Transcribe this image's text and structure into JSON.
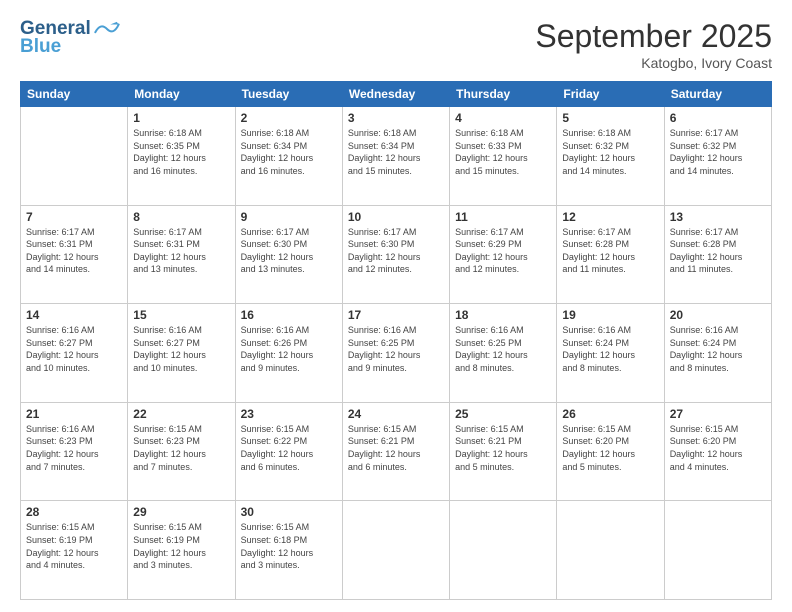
{
  "header": {
    "logo_line1": "General",
    "logo_line2": "Blue",
    "month_title": "September 2025",
    "location": "Katogbo, Ivory Coast"
  },
  "weekdays": [
    "Sunday",
    "Monday",
    "Tuesday",
    "Wednesday",
    "Thursday",
    "Friday",
    "Saturday"
  ],
  "weeks": [
    [
      {
        "day": "",
        "info": ""
      },
      {
        "day": "1",
        "info": "Sunrise: 6:18 AM\nSunset: 6:35 PM\nDaylight: 12 hours\nand 16 minutes."
      },
      {
        "day": "2",
        "info": "Sunrise: 6:18 AM\nSunset: 6:34 PM\nDaylight: 12 hours\nand 16 minutes."
      },
      {
        "day": "3",
        "info": "Sunrise: 6:18 AM\nSunset: 6:34 PM\nDaylight: 12 hours\nand 15 minutes."
      },
      {
        "day": "4",
        "info": "Sunrise: 6:18 AM\nSunset: 6:33 PM\nDaylight: 12 hours\nand 15 minutes."
      },
      {
        "day": "5",
        "info": "Sunrise: 6:18 AM\nSunset: 6:32 PM\nDaylight: 12 hours\nand 14 minutes."
      },
      {
        "day": "6",
        "info": "Sunrise: 6:17 AM\nSunset: 6:32 PM\nDaylight: 12 hours\nand 14 minutes."
      }
    ],
    [
      {
        "day": "7",
        "info": "Sunrise: 6:17 AM\nSunset: 6:31 PM\nDaylight: 12 hours\nand 14 minutes."
      },
      {
        "day": "8",
        "info": "Sunrise: 6:17 AM\nSunset: 6:31 PM\nDaylight: 12 hours\nand 13 minutes."
      },
      {
        "day": "9",
        "info": "Sunrise: 6:17 AM\nSunset: 6:30 PM\nDaylight: 12 hours\nand 13 minutes."
      },
      {
        "day": "10",
        "info": "Sunrise: 6:17 AM\nSunset: 6:30 PM\nDaylight: 12 hours\nand 12 minutes."
      },
      {
        "day": "11",
        "info": "Sunrise: 6:17 AM\nSunset: 6:29 PM\nDaylight: 12 hours\nand 12 minutes."
      },
      {
        "day": "12",
        "info": "Sunrise: 6:17 AM\nSunset: 6:28 PM\nDaylight: 12 hours\nand 11 minutes."
      },
      {
        "day": "13",
        "info": "Sunrise: 6:17 AM\nSunset: 6:28 PM\nDaylight: 12 hours\nand 11 minutes."
      }
    ],
    [
      {
        "day": "14",
        "info": "Sunrise: 6:16 AM\nSunset: 6:27 PM\nDaylight: 12 hours\nand 10 minutes."
      },
      {
        "day": "15",
        "info": "Sunrise: 6:16 AM\nSunset: 6:27 PM\nDaylight: 12 hours\nand 10 minutes."
      },
      {
        "day": "16",
        "info": "Sunrise: 6:16 AM\nSunset: 6:26 PM\nDaylight: 12 hours\nand 9 minutes."
      },
      {
        "day": "17",
        "info": "Sunrise: 6:16 AM\nSunset: 6:25 PM\nDaylight: 12 hours\nand 9 minutes."
      },
      {
        "day": "18",
        "info": "Sunrise: 6:16 AM\nSunset: 6:25 PM\nDaylight: 12 hours\nand 8 minutes."
      },
      {
        "day": "19",
        "info": "Sunrise: 6:16 AM\nSunset: 6:24 PM\nDaylight: 12 hours\nand 8 minutes."
      },
      {
        "day": "20",
        "info": "Sunrise: 6:16 AM\nSunset: 6:24 PM\nDaylight: 12 hours\nand 8 minutes."
      }
    ],
    [
      {
        "day": "21",
        "info": "Sunrise: 6:16 AM\nSunset: 6:23 PM\nDaylight: 12 hours\nand 7 minutes."
      },
      {
        "day": "22",
        "info": "Sunrise: 6:15 AM\nSunset: 6:23 PM\nDaylight: 12 hours\nand 7 minutes."
      },
      {
        "day": "23",
        "info": "Sunrise: 6:15 AM\nSunset: 6:22 PM\nDaylight: 12 hours\nand 6 minutes."
      },
      {
        "day": "24",
        "info": "Sunrise: 6:15 AM\nSunset: 6:21 PM\nDaylight: 12 hours\nand 6 minutes."
      },
      {
        "day": "25",
        "info": "Sunrise: 6:15 AM\nSunset: 6:21 PM\nDaylight: 12 hours\nand 5 minutes."
      },
      {
        "day": "26",
        "info": "Sunrise: 6:15 AM\nSunset: 6:20 PM\nDaylight: 12 hours\nand 5 minutes."
      },
      {
        "day": "27",
        "info": "Sunrise: 6:15 AM\nSunset: 6:20 PM\nDaylight: 12 hours\nand 4 minutes."
      }
    ],
    [
      {
        "day": "28",
        "info": "Sunrise: 6:15 AM\nSunset: 6:19 PM\nDaylight: 12 hours\nand 4 minutes."
      },
      {
        "day": "29",
        "info": "Sunrise: 6:15 AM\nSunset: 6:19 PM\nDaylight: 12 hours\nand 3 minutes."
      },
      {
        "day": "30",
        "info": "Sunrise: 6:15 AM\nSunset: 6:18 PM\nDaylight: 12 hours\nand 3 minutes."
      },
      {
        "day": "",
        "info": ""
      },
      {
        "day": "",
        "info": ""
      },
      {
        "day": "",
        "info": ""
      },
      {
        "day": "",
        "info": ""
      }
    ]
  ]
}
